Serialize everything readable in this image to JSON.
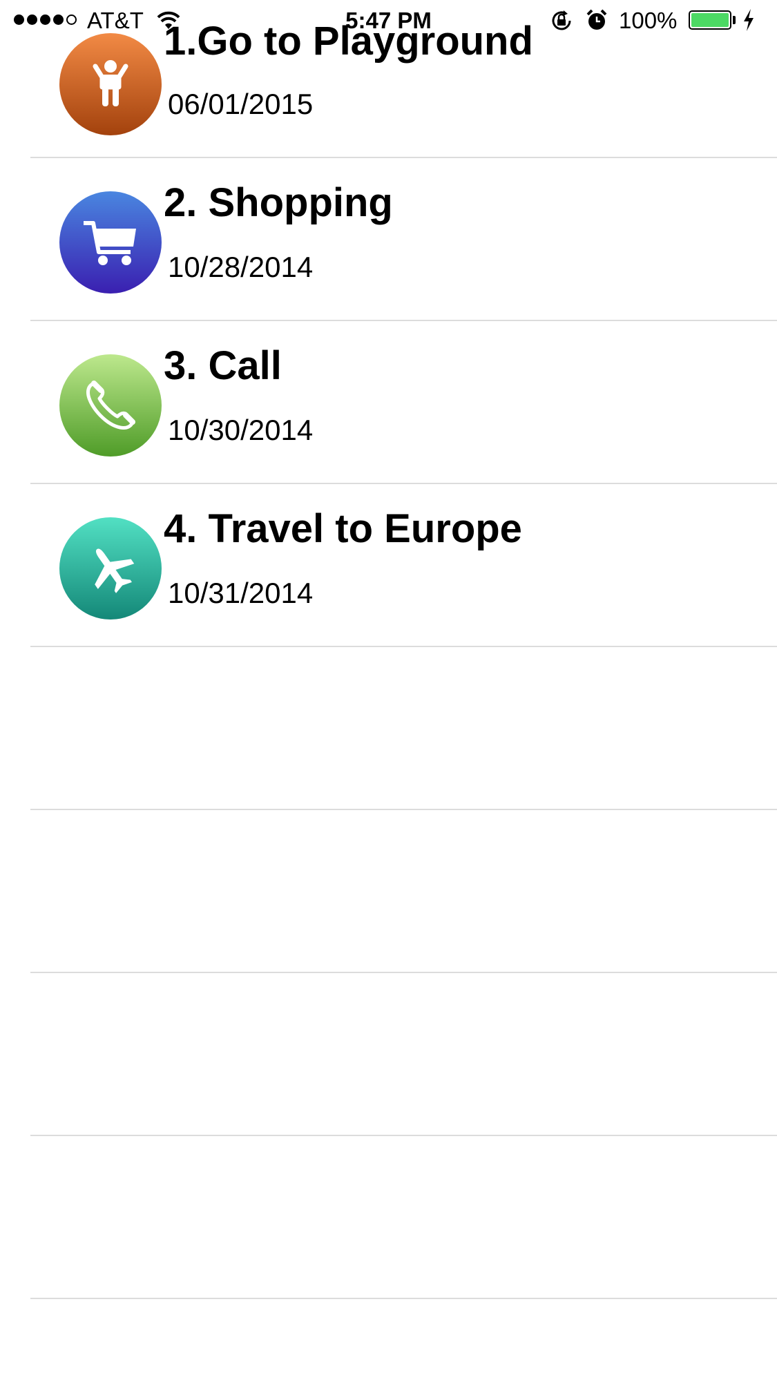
{
  "status_bar": {
    "carrier": "AT&T",
    "time": "5:47 PM",
    "battery_percent": "100%",
    "battery_level": 1.0,
    "signal_bars_filled": 4,
    "signal_bars_total": 5,
    "battery_color": "#4cd964",
    "icons": [
      "signal-dots",
      "wifi-icon",
      "rotation-lock-icon",
      "alarm-icon",
      "battery-icon",
      "charging-icon"
    ]
  },
  "tasks": [
    {
      "title": "1.Go to Playground",
      "date": "06/01/2015",
      "icon": "child-icon",
      "gradient": [
        "#f28a45",
        "#a3420d"
      ]
    },
    {
      "title": "2. Shopping",
      "date": "10/28/2014",
      "icon": "shopping-cart-icon",
      "gradient": [
        "#4a86e0",
        "#3a1fb0"
      ]
    },
    {
      "title": "3. Call",
      "date": "10/30/2014",
      "icon": "phone-icon",
      "gradient": [
        "#bde88d",
        "#4f9c28"
      ]
    },
    {
      "title": "4. Travel to Europe",
      "date": "10/31/2014",
      "icon": "airplane-icon",
      "gradient": [
        "#52e0c3",
        "#148878"
      ]
    }
  ],
  "empty_rows": 4
}
